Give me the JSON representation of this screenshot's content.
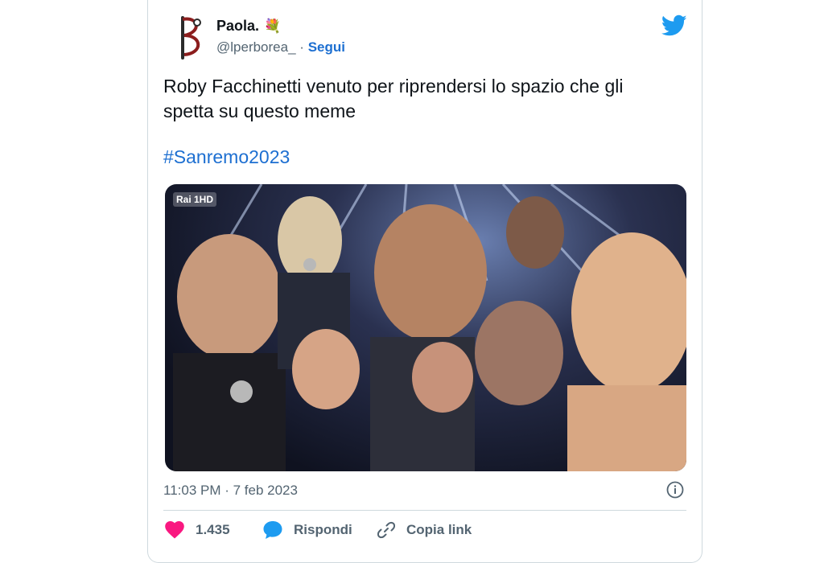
{
  "tweet": {
    "author_name": "Paola.",
    "author_emoji": "💐",
    "handle": "@lperborea_",
    "separator": "·",
    "follow_label": "Segui",
    "text": "Roby Facchinetti venuto per riprendersi lo spazio che gli spetta su questo meme",
    "hashtag": "#Sanremo2023",
    "media_badge": "Rai 1HD",
    "timestamp": "11:03 PM · 7 feb 2023"
  },
  "actions": {
    "likes_count": "1.435",
    "reply_label": "Rispondi",
    "copy_link_label": "Copia link"
  },
  "icons": {
    "bird": "twitter-bird-icon",
    "info": "info-icon",
    "heart": "heart-icon",
    "reply": "reply-bubble-icon",
    "link": "link-icon"
  },
  "colors": {
    "link": "#1d6fd1",
    "twitter_blue": "#1d9bf0",
    "heart": "#f91880",
    "muted": "#536471",
    "border": "#cfd9de"
  }
}
